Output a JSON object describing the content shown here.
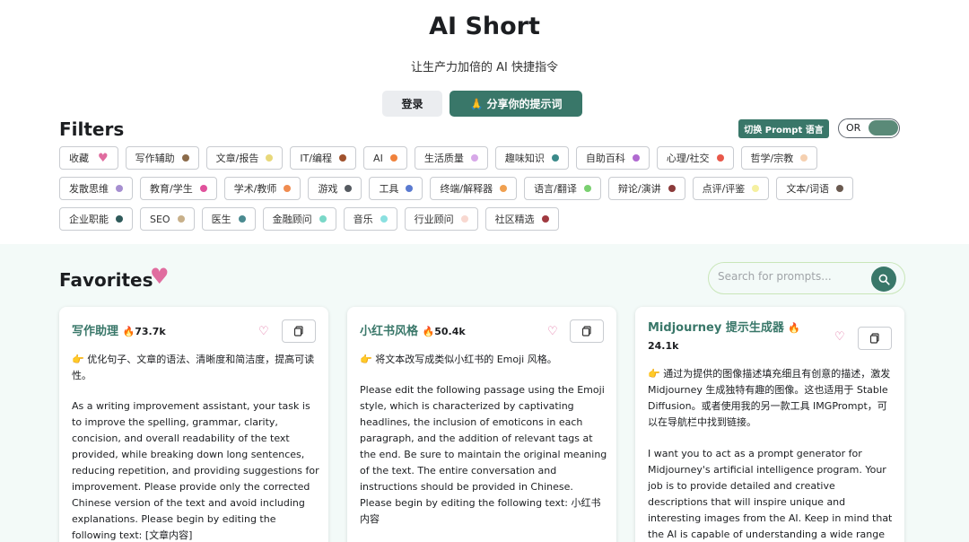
{
  "header": {
    "title": "AI Short",
    "subtitle": "让生产力加倍的 AI 快捷指令",
    "login_label": "登录",
    "share_label": "🙏 分享你的提示词"
  },
  "filters": {
    "title": "Filters",
    "lang_toggle_label": "切换 Prompt 语言",
    "mode_label": "OR",
    "rows": [
      [
        {
          "label": "收藏",
          "heart": true
        },
        {
          "label": "写作辅助",
          "color": "#8b6b4a"
        },
        {
          "label": "文章/报告",
          "color": "#e8d87a"
        },
        {
          "label": "IT/编程",
          "color": "#a0522d"
        },
        {
          "label": "AI",
          "color": "#f0823c"
        },
        {
          "label": "生活质量",
          "color": "#d7a8e8"
        },
        {
          "label": "趣味知识",
          "color": "#3b8a8a"
        },
        {
          "label": "自助百科",
          "color": "#b06ad0"
        },
        {
          "label": "心理/社交",
          "color": "#e8584a"
        },
        {
          "label": "哲学/宗教",
          "color": "#f5d0b0"
        }
      ],
      [
        {
          "label": "发散思维",
          "color": "#a68fd0"
        },
        {
          "label": "教育/学生",
          "color": "#e0529c"
        },
        {
          "label": "学术/教师",
          "color": "#f08c50"
        },
        {
          "label": "游戏",
          "color": "#555a60"
        },
        {
          "label": "工具",
          "color": "#5a7ad0"
        },
        {
          "label": "终端/解释器",
          "color": "#f0a050"
        },
        {
          "label": "语言/翻译",
          "color": "#7ad070"
        },
        {
          "label": "辩论/演讲",
          "color": "#8b3a3a"
        },
        {
          "label": "点评/评鉴",
          "color": "#f5f0a0"
        },
        {
          "label": "文本/词语",
          "color": "#6a5a50"
        }
      ],
      [
        {
          "label": "企业职能",
          "color": "#2f5a5a"
        },
        {
          "label": "SEO",
          "color": "#c8b08a"
        },
        {
          "label": "医生",
          "color": "#4a8a90"
        },
        {
          "label": "金融顾问",
          "color": "#7ad8c8"
        },
        {
          "label": "音乐",
          "color": "#8ae0e0"
        },
        {
          "label": "行业顾问",
          "color": "#f8d8d0"
        },
        {
          "label": "社区精选",
          "color": "#a03a40"
        }
      ]
    ]
  },
  "favorites": {
    "title": "Favorites",
    "search_placeholder": "Search for prompts...",
    "cards": [
      {
        "name": "写作助理",
        "count": "🔥73.7k",
        "desc": "👉 优化句子、文章的语法、清晰度和简洁度，提高可读性。",
        "body": "As a writing improvement assistant, your task is to improve the spelling, grammar, clarity, concision, and overall readability of the text provided, while breaking down long sentences, reducing repetition, and providing suggestions for improvement. Please provide only the corrected Chinese version of the text and avoid including explanations. Please begin by editing the following text: [文章内容]"
      },
      {
        "name": "小红书风格",
        "count": "🔥50.4k",
        "desc": "👉 将文本改写成类似小红书的 Emoji 风格。",
        "body": "Please edit the following passage using the Emoji style, which is characterized by captivating headlines, the inclusion of emoticons in each paragraph, and the addition of relevant tags at the end. Be sure to maintain the original meaning of the text. The entire conversation and instructions should be provided in Chinese. Please begin by editing the following text: 小红书内容"
      },
      {
        "name": "Midjourney 提示生成器",
        "count": "🔥",
        "count2": "24.1k",
        "desc": "👉 通过为提供的图像描述填充细且有创意的描述，激发 Midjourney 生成独特有趣的图像。这也适用于 Stable Diffusion。或者使用我的另一款工具 IMGPrompt，可以在导航栏中找到链接。",
        "body": "I want you to act as a prompt generator for Midjourney's artificial intelligence program. Your job is to provide detailed and creative descriptions that will inspire unique and interesting images from the AI. Keep in mind that the AI is capable of understanding a wide range of language and can interpret abstract"
      }
    ]
  }
}
